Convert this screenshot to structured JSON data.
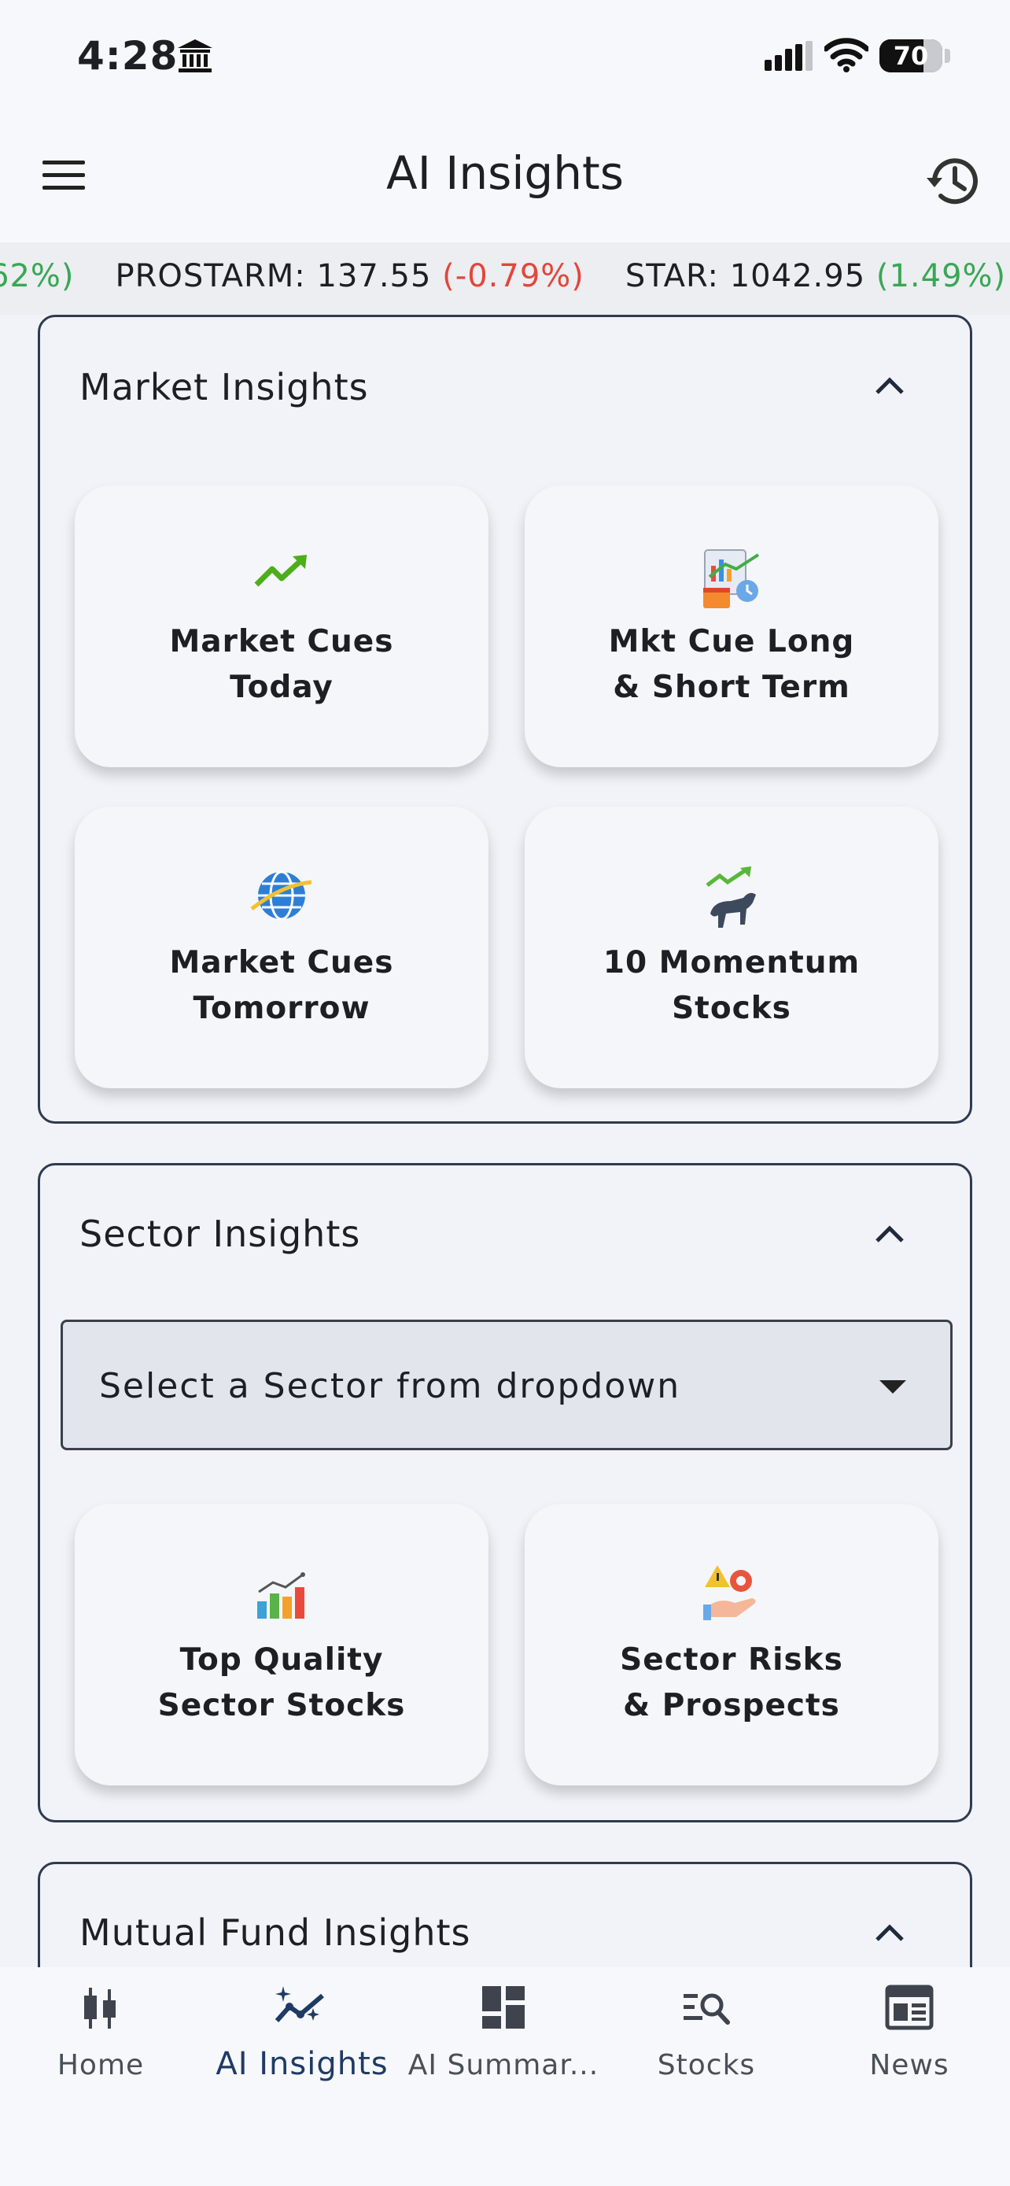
{
  "status": {
    "time": "4:28",
    "battery": "70",
    "battery_level": 0.7
  },
  "header": {
    "title": "AI Insights"
  },
  "ticker": [
    {
      "value": "62%)",
      "class": "up"
    },
    {
      "label": "PROSTARM: 137.55 ",
      "change": "(-0.79%)",
      "class": "down"
    },
    {
      "label": "STAR: 1042.95 ",
      "change": "(1.49%)",
      "class": "up"
    }
  ],
  "market": {
    "title": "Market Insights",
    "cards": [
      {
        "label": "Market Cues\nToday",
        "icon": "trending-up-icon"
      },
      {
        "label": "Mkt Cue Long\n& Short Term",
        "icon": "chart-calendar-icon"
      },
      {
        "label": "Market Cues\nTomorrow",
        "icon": "globe-icon"
      },
      {
        "label": "10 Momentum\nStocks",
        "icon": "bull-icon"
      }
    ]
  },
  "sector": {
    "title": "Sector Insights",
    "dropdown": "Select a Sector from dropdown",
    "cards": [
      {
        "label": "Top Quality\nSector Stocks",
        "icon": "bar-chart-icon"
      },
      {
        "label": "Sector Risks\n& Prospects",
        "icon": "risk-gear-icon"
      }
    ]
  },
  "mutual": {
    "title": "Mutual Fund Insights"
  },
  "tabs": [
    {
      "label": "Home",
      "icon": "candlestick-icon"
    },
    {
      "label": "AI Insights",
      "icon": "ai-trend-icon",
      "active": true
    },
    {
      "label": "AI Summar...",
      "icon": "dashboard-icon"
    },
    {
      "label": "Stocks",
      "icon": "list-search-icon"
    },
    {
      "label": "News",
      "icon": "newspaper-icon"
    }
  ],
  "colors": {
    "up": "#3aa655",
    "down": "#e2463b",
    "accent": "#1f3b64"
  }
}
